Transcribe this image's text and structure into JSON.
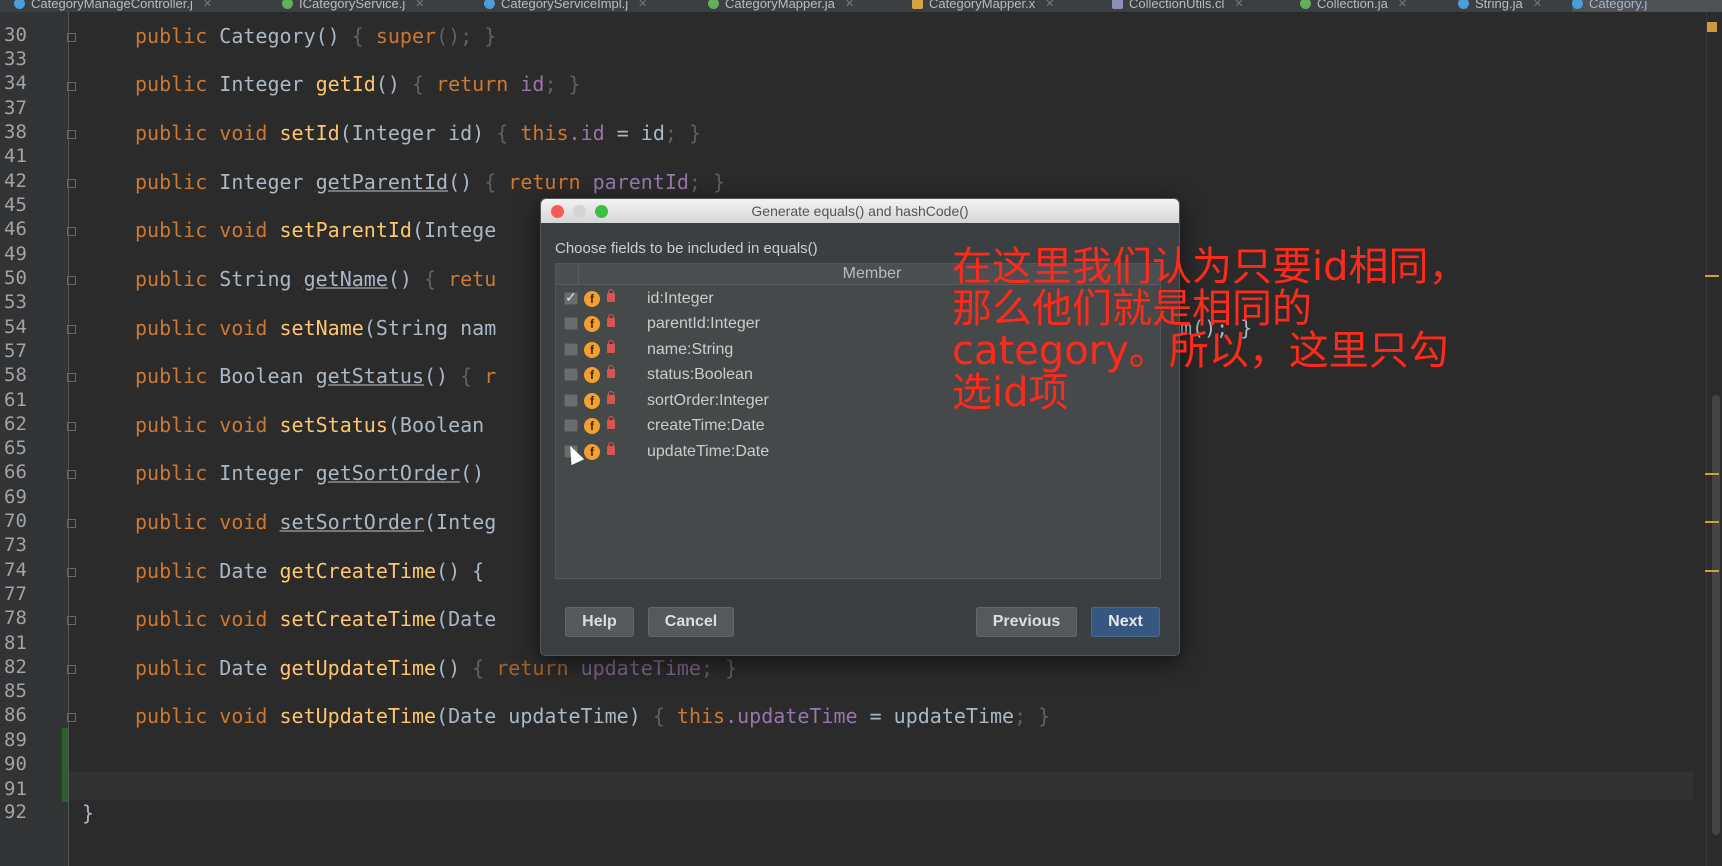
{
  "tabs": [
    {
      "label": "CategoryManageController.j",
      "icon": "class-icon"
    },
    {
      "label": "ICategoryService.j",
      "icon": "interface-icon"
    },
    {
      "label": "CategoryServiceImpl.j",
      "icon": "class-icon"
    },
    {
      "label": "CategoryMapper.ja",
      "icon": "interface-icon"
    },
    {
      "label": "CategoryMapper.x",
      "icon": "xml-icon"
    },
    {
      "label": "CollectionUtils.cl",
      "icon": "decompiled-class-icon"
    },
    {
      "label": "Collection.ja",
      "icon": "interface-icon"
    },
    {
      "label": "String.ja",
      "icon": "class-icon"
    },
    {
      "label": "Category.j",
      "icon": "class-icon"
    }
  ],
  "line_numbers": [
    "30",
    "33",
    "34",
    "37",
    "38",
    "41",
    "42",
    "45",
    "46",
    "49",
    "50",
    "53",
    "54",
    "57",
    "58",
    "61",
    "62",
    "65",
    "66",
    "69",
    "70",
    "73",
    "74",
    "77",
    "78",
    "81",
    "82",
    "85",
    "86",
    "89",
    "90",
    "91",
    "92"
  ],
  "code": {
    "l30": {
      "kw": "public",
      "rest": " Category() ",
      "body_kw": "super",
      "body_end": "(); }"
    },
    "l34": {
      "kw": "public",
      "type": " Integer ",
      "fn": "getId",
      "args": "() ",
      "brace": "{ ",
      "ret": "return",
      "fld": "id",
      "end": "; }"
    },
    "l38": {
      "kw": "public",
      "kw2": "void",
      "fn": "setId",
      "args": "(Integer id) ",
      "brace": "{ ",
      "this": "this",
      "fld": ".id",
      "asg": " = id",
      "end": "; }"
    },
    "l42": {
      "kw": "public",
      "type": " Integer ",
      "fn": "getParentId",
      "args": "() ",
      "brace": "{ ",
      "ret": "return",
      "fld": "parentId",
      "end": "; }"
    },
    "l46": {
      "kw": "public",
      "kw2": "void",
      "fn": "setParentId",
      "args": "(Intege"
    },
    "l50": {
      "kw": "public",
      "type": " String ",
      "fn": "getName",
      "args": "() ",
      "brace": "{ ",
      "ret": "retu"
    },
    "l54": {
      "kw": "public",
      "kw2": "void",
      "fn": "setName",
      "args": "(String nam",
      "tail": "m(); }"
    },
    "l58": {
      "kw": "public",
      "type": " Boolean ",
      "fn": "getStatus",
      "args": "() ",
      "brace": "{ ",
      "ret": "r"
    },
    "l62": {
      "kw": "public",
      "kw2": "void",
      "fn": "setStatus",
      "args": "(Boolean "
    },
    "l66": {
      "kw": "public",
      "type": " Integer ",
      "fn": "getSortOrder",
      "args": "()"
    },
    "l70": {
      "kw": "public",
      "kw2": "void",
      "fn": "setSortOrder",
      "args": "(Integ"
    },
    "l74": {
      "kw": "public",
      "type": " Date ",
      "fn": "getCreateTime",
      "args": "() {"
    },
    "l78": {
      "kw": "public",
      "kw2": "void",
      "fn": "setCreateTime",
      "args": "(Date"
    },
    "l82": {
      "kw": "public",
      "type": " Date ",
      "fn": "getUpdateTime",
      "args": "() ",
      "brace": "{ ",
      "ret": "return",
      "fld": "updateTime",
      "end": "; }"
    },
    "l86": {
      "kw": "public",
      "kw2": "void",
      "fn": "setUpdateTime",
      "args": "(Date updateTime) ",
      "brace": "{ ",
      "this": "this",
      "fld": ".updateTime",
      "asg": " = updateTime",
      "end": "; }"
    },
    "l92": "}"
  },
  "dialog": {
    "title": "Generate equals() and hashCode()",
    "subtitle": "Choose fields to be included in equals()",
    "column_header": "Member",
    "fields": [
      {
        "label": "id:Integer",
        "checked": true
      },
      {
        "label": "parentId:Integer",
        "checked": false
      },
      {
        "label": "name:String",
        "checked": false
      },
      {
        "label": "status:Boolean",
        "checked": false
      },
      {
        "label": "sortOrder:Integer",
        "checked": false
      },
      {
        "label": "createTime:Date",
        "checked": false
      },
      {
        "label": "updateTime:Date",
        "checked": false
      }
    ],
    "buttons": {
      "help": "Help",
      "cancel": "Cancel",
      "previous": "Previous",
      "next": "Next"
    }
  },
  "annotation": "在这里我们认为只要id相同，那么他们就是相同的category。所以，这里只勾选id项",
  "colors": {
    "keyword": "#cc7832",
    "method": "#ffc66d",
    "field": "#9876aa",
    "annotation": "#ff2a1a"
  }
}
